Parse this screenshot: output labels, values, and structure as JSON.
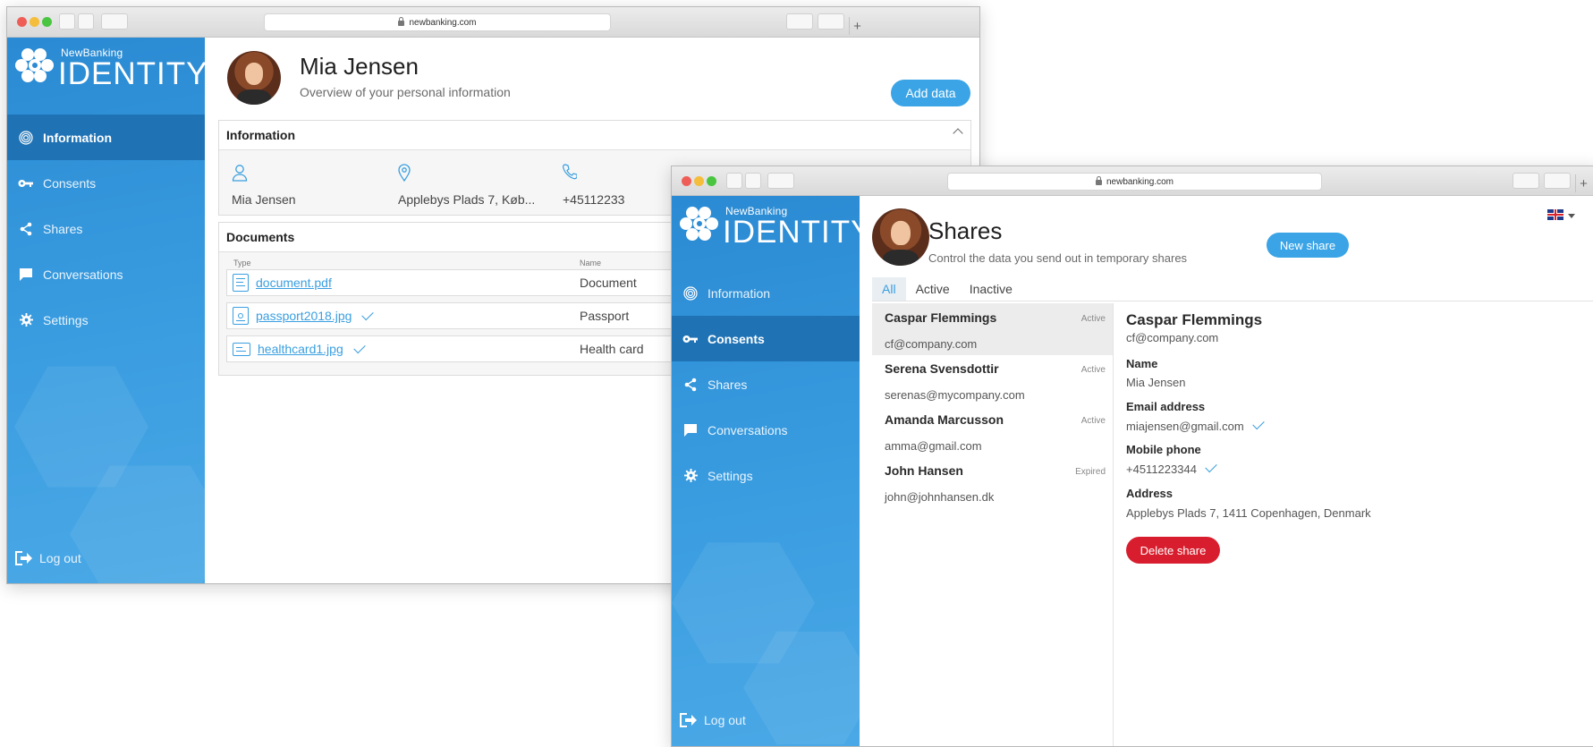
{
  "window1": {
    "url": "newbanking.com",
    "logo": {
      "small": "NewBanking",
      "big": "IDENTITY"
    },
    "nav": [
      {
        "label": "Information",
        "icon": "fingerprint-icon",
        "active": true
      },
      {
        "label": "Consents",
        "icon": "key-icon",
        "active": false
      },
      {
        "label": "Shares",
        "icon": "share-icon",
        "active": false
      },
      {
        "label": "Conversations",
        "icon": "chat-icon",
        "active": false
      },
      {
        "label": "Settings",
        "icon": "gear-icon",
        "active": false
      }
    ],
    "logout": "Log out",
    "profile": {
      "name": "Mia Jensen",
      "subtitle": "Overview of your personal information"
    },
    "add_button": "Add data",
    "information": {
      "title": "Information",
      "name": "Mia Jensen",
      "address": "Applebys Plads 7, Køb...",
      "phone": "+45112233"
    },
    "documents": {
      "title": "Documents",
      "headers": {
        "type": "Type",
        "name": "Name"
      },
      "rows": [
        {
          "file": "document.pdf",
          "type": "Document",
          "verified": false
        },
        {
          "file": "passport2018.jpg",
          "type": "Passport",
          "verified": true
        },
        {
          "file": "healthcard1.jpg",
          "type": "Health card",
          "verified": true
        }
      ]
    }
  },
  "window2": {
    "url": "newbanking.com",
    "logo": {
      "small": "NewBanking",
      "big": "IDENTITY"
    },
    "nav": [
      {
        "label": "Information",
        "icon": "fingerprint-icon",
        "active": false
      },
      {
        "label": "Consents",
        "icon": "key-icon",
        "active": true
      },
      {
        "label": "Shares",
        "icon": "share-icon",
        "active": false
      },
      {
        "label": "Conversations",
        "icon": "chat-icon",
        "active": false
      },
      {
        "label": "Settings",
        "icon": "gear-icon",
        "active": false
      }
    ],
    "logout": "Log out",
    "page": {
      "title": "Shares",
      "subtitle": "Control the data you send out in temporary shares"
    },
    "new_button": "New share",
    "tabs": [
      "All",
      "Active",
      "Inactive"
    ],
    "shares": [
      {
        "name": "Caspar Flemmings",
        "email": "cf@company.com",
        "status": "Active"
      },
      {
        "name": "Serena Svensdottir",
        "email": "serenas@mycompany.com",
        "status": "Active"
      },
      {
        "name": "Amanda Marcusson",
        "email": "amma@gmail.com",
        "status": "Active"
      },
      {
        "name": "John Hansen",
        "email": "john@johnhansen.dk",
        "status": "Expired"
      }
    ],
    "detail": {
      "name": "Caspar Flemmings",
      "email": "cf@company.com",
      "fields": [
        {
          "label": "Name",
          "value": "Mia Jensen",
          "verified": false
        },
        {
          "label": "Email address",
          "value": "miajensen@gmail.com",
          "verified": true
        },
        {
          "label": "Mobile phone",
          "value": "+4511223344",
          "verified": true
        },
        {
          "label": "Address",
          "value": "Applebys Plads 7, 1411 Copenhagen, Denmark",
          "verified": false
        }
      ],
      "delete_button": "Delete share"
    }
  },
  "colors": {
    "accent": "#3aa4e6",
    "sidebar": "#2f92da",
    "nav_active": "#1f73b5",
    "danger": "#d81e2e"
  }
}
